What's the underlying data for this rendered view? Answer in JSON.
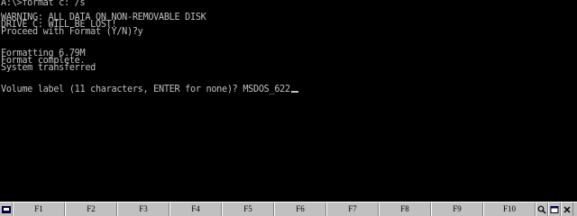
{
  "terminal": {
    "lines": {
      "l01": "A:\\>format c: /s",
      "l02": "",
      "l03": "WARNING: ALL DATA ON NON-REMOVABLE DISK",
      "l04": "DRIVE C: WILL BE LOST!",
      "l05": "Proceed with Format (Y/N)?y",
      "l06": "",
      "l07": "",
      "l08": "Formatting 6.79M",
      "l09": "Format complete.",
      "l10": "System transferred",
      "l11": "",
      "l12": "",
      "l13": "Volume label (11 characters, ENTER for none)? MSDOS_622"
    }
  },
  "fkeybar": {
    "keys": [
      "F1",
      "F2",
      "F3",
      "F4",
      "F5",
      "F6",
      "F7",
      "F8",
      "F9",
      "F10"
    ],
    "icons": [
      "dos-app-icon",
      "magnifier-icon",
      "window-icon",
      "close-icon"
    ]
  }
}
